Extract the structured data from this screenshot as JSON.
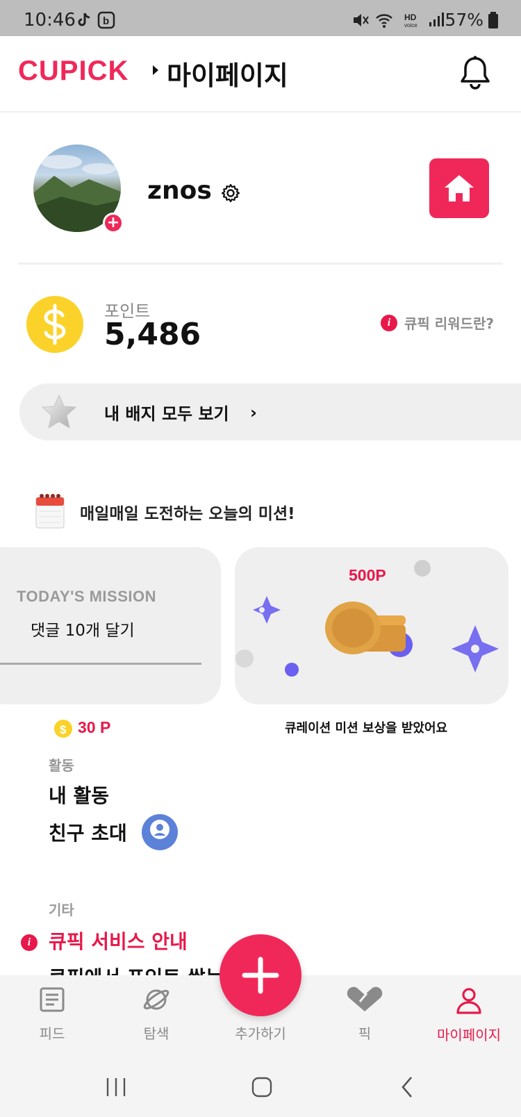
{
  "status_bar": {
    "time": "10:46",
    "battery": "57%"
  },
  "header": {
    "logo": "CUPICK",
    "title": "마이페이지"
  },
  "profile": {
    "username": "znos"
  },
  "points": {
    "label": "포인트",
    "value": "5,486",
    "rewards_link": "큐픽 리워드란?"
  },
  "badges": {
    "label": "내 배지 모두 보기"
  },
  "daily_mission": {
    "title": "매일매일 도전하는 오늘의 미션!",
    "eyebrow": "TODAY'S MISSION",
    "task": "댓글 10개 달기",
    "points": "30 P",
    "reward_points": "500P",
    "reward_caption": "큐레이션 미션 보상을 받았어요"
  },
  "activity": {
    "section_label": "활동",
    "my_activity": "내 활동",
    "invite_friends": "친구 초대"
  },
  "other": {
    "section_label": "기타",
    "service_info": "큐픽 서비스 안내",
    "earn_points": "큐픽에서 포인트 쌓는"
  },
  "bottom_nav": [
    {
      "label": "피드",
      "icon": "feed-icon"
    },
    {
      "label": "탐색",
      "icon": "explore-icon"
    },
    {
      "label": "추가하기",
      "icon": "add-icon"
    },
    {
      "label": "픽",
      "icon": "pick-icon"
    },
    {
      "label": "마이페이지",
      "icon": "person-icon",
      "active": true
    }
  ],
  "colors": {
    "accent": "#f0285a",
    "coin": "#fbd22a",
    "mission_bg": "#efefef"
  }
}
